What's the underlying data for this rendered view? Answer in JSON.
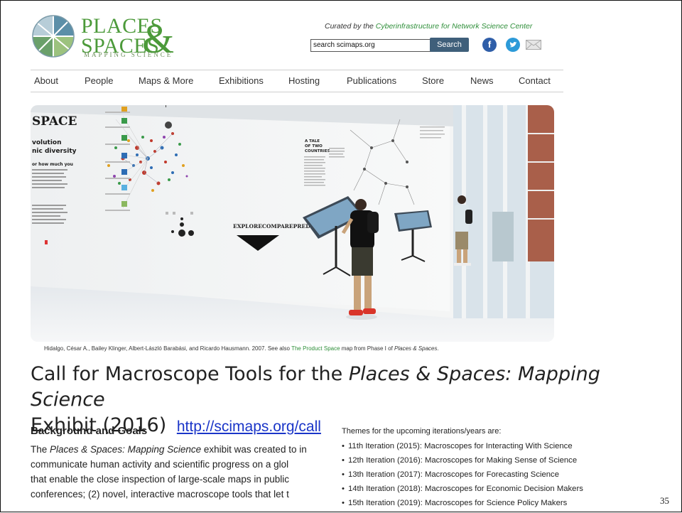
{
  "logo": {
    "line1": "PLACES",
    "line2": "SPACES",
    "amp": "&",
    "subtitle": "MAPPING SCIENCE"
  },
  "header": {
    "curated_prefix": "Curated by the ",
    "curated_link": "Cyberinfrastructure for Network Science Center",
    "search_value": "search scimaps.org",
    "search_button": "Search",
    "facebook_glyph": "f",
    "twitter_glyph": "t"
  },
  "nav": [
    "About",
    "People",
    "Maps & More",
    "Exhibitions",
    "Hosting",
    "Publications",
    "Store",
    "News",
    "Contact"
  ],
  "photo": {
    "wall_title": "SPACE",
    "wall_sub1": "volution",
    "wall_sub2": "nic diversity",
    "wall_note": "or how much you",
    "tale": [
      "A TALE",
      "OF TWO",
      "COUNTRIES"
    ],
    "banner": "EXPLORECOMPAREPREDICT"
  },
  "caption": {
    "text": "Hidalgo, César A., Bailey Klinger, Albert-László Barabási, and Ricardo Hausmann. 2007. See also ",
    "link": "The Product Space",
    "after": " map from Phase I of ",
    "italic": "Places & Spaces",
    "end": "."
  },
  "headline": {
    "part1": "Call for Macroscope Tools for the ",
    "italic": "Places & Spaces: Mapping Science",
    "part2": "Exhibit (2016)",
    "url": "http://scimaps.org/call"
  },
  "background": {
    "title": "Background and Goals",
    "line1_a": "The ",
    "line1_italic": "Places & Spaces: Mapping Science",
    "line1_b": " exhibit was created to in",
    "line2": "communicate human activity and scientific progress on a glol",
    "line3": "that enable the close inspection of large-scale maps in public",
    "line4": "conferences; (2) novel, interactive macroscope tools that let t"
  },
  "themes": {
    "title": "Themes for the upcoming iterations/years are:",
    "items": [
      "11th Iteration (2015): Macroscopes for Interacting With Science",
      "12th Iteration (2016): Macroscopes for Making Sense of Science",
      "13th Iteration (2017): Macroscopes for Forecasting Science",
      "14th Iteration (2018): Macroscopes for Economic Decision Makers",
      "15th Iteration (2019): Macroscopes for Science Policy Makers"
    ]
  },
  "slide_number": "35",
  "colors": {
    "brand_green": "#4c9a3a",
    "link_green": "#2f8f3a",
    "url_blue": "#1a35c8",
    "search_button": "#3f5f7a"
  }
}
